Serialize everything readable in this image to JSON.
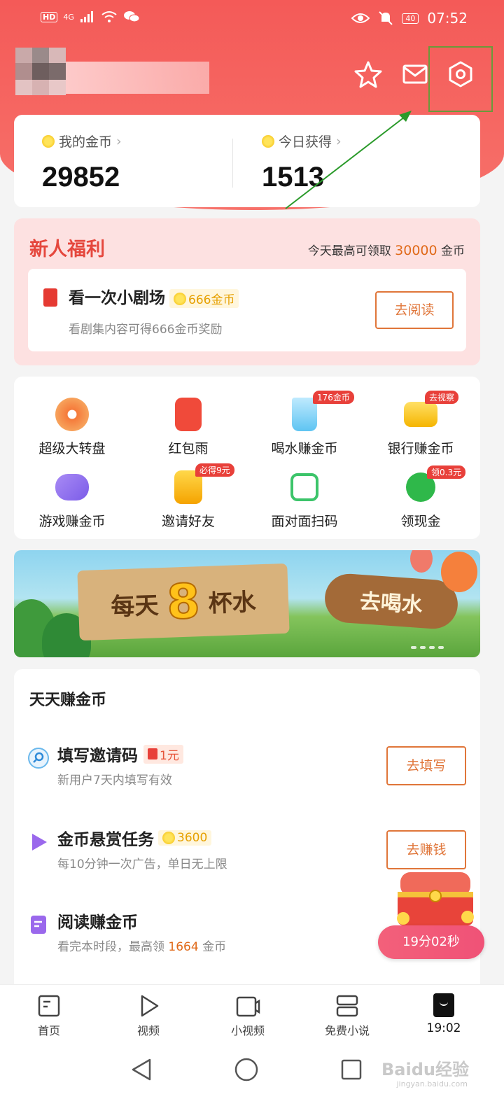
{
  "status_bar": {
    "hd": "HD",
    "network": "4G",
    "battery": "40",
    "time": "07:52"
  },
  "header": {
    "icons": [
      "star-icon",
      "mail-icon",
      "settings-icon"
    ]
  },
  "coins": {
    "my_coins_label": "我的金币",
    "my_coins_value": "29852",
    "today_label": "今日获得",
    "today_value": "1513"
  },
  "newbie": {
    "title": "新人福利",
    "hint_prefix": "今天最高可领取",
    "hint_amount": "30000",
    "hint_suffix": "金币",
    "task_title": "看一次小剧场",
    "task_reward": "666金币",
    "task_sub": "看剧集内容可得666金币奖励",
    "task_button": "去阅读"
  },
  "grid": {
    "items": [
      {
        "label": "超级大转盘",
        "badge": ""
      },
      {
        "label": "红包雨",
        "badge": ""
      },
      {
        "label": "喝水赚金币",
        "badge": "176金币"
      },
      {
        "label": "银行赚金币",
        "badge": "去视察"
      },
      {
        "label": "游戏赚金币",
        "badge": ""
      },
      {
        "label": "邀请好友",
        "badge": "必得9元"
      },
      {
        "label": "面对面扫码",
        "badge": ""
      },
      {
        "label": "领现金",
        "badge": "领0.3元"
      }
    ]
  },
  "banner": {
    "text_1": "每天",
    "text_8": "8",
    "text_2": "杯水",
    "sign": "去喝水"
  },
  "daily": {
    "title": "天天赚金币",
    "rows": [
      {
        "title": "填写邀请码",
        "tag": "1元",
        "sub": "新用户7天内填写有效",
        "button": "去填写"
      },
      {
        "title": "金币悬赏任务",
        "tag": "3600",
        "sub": "每10分钟一次广告，单日无上限",
        "button": "去赚钱"
      },
      {
        "title": "阅读赚金币",
        "tag": "",
        "sub_prefix": "看完本时段，最高领",
        "sub_amount": "1664",
        "sub_suffix": "金币",
        "button": ""
      }
    ]
  },
  "timer": "19分02秒",
  "bottom_nav": {
    "items": [
      {
        "label": "首页"
      },
      {
        "label": "视频"
      },
      {
        "label": "小视频"
      },
      {
        "label": "免费小说"
      },
      {
        "label": "19:02"
      }
    ]
  },
  "watermark": {
    "main": "Baidu经验",
    "sub": "jingyan.baidu.com"
  },
  "colors": {
    "header": "#f45a58",
    "accent_orange": "#e0763a",
    "badge_red": "#e8403a",
    "newbie_bg": "#fde1e1"
  }
}
